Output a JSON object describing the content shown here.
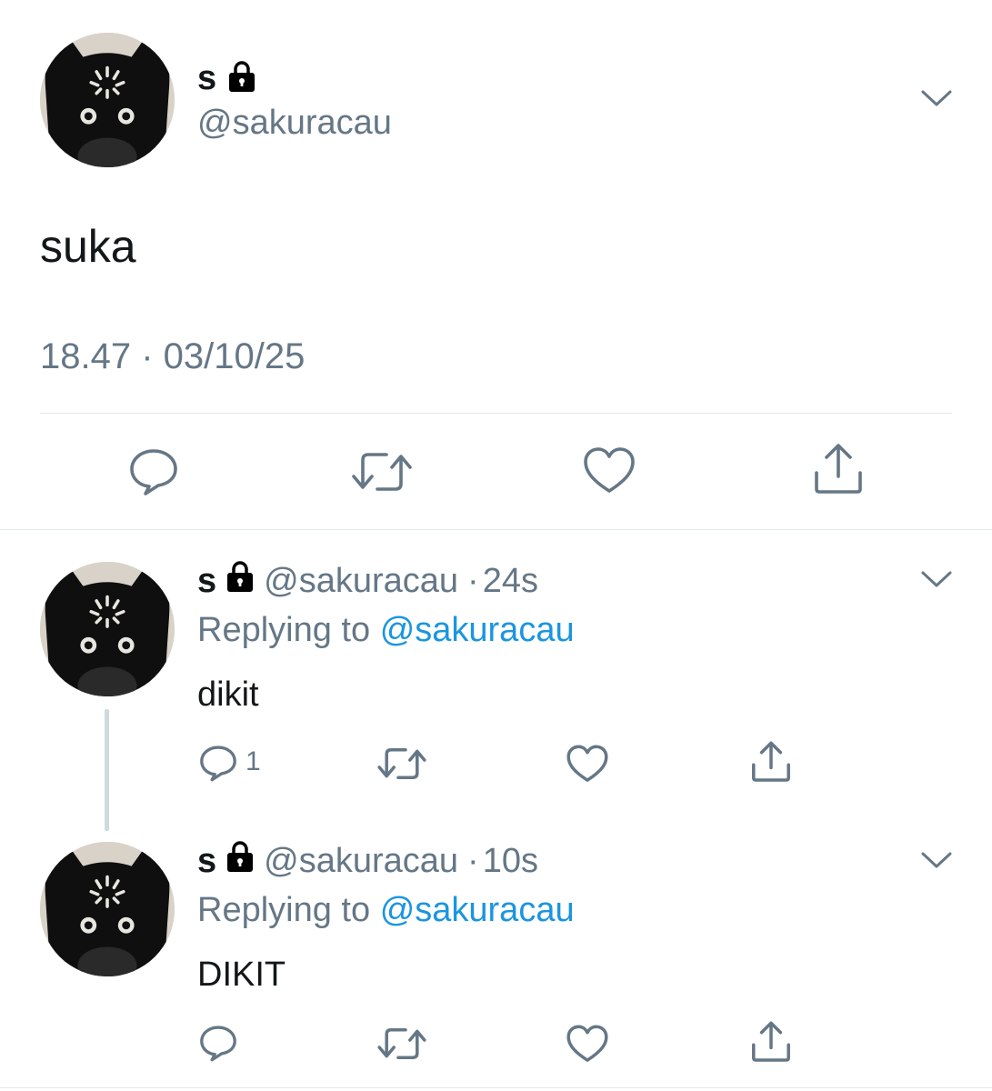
{
  "main_tweet": {
    "display_name": "s",
    "handle": "@sakuracau",
    "text": "suka",
    "timestamp": "18.47 · 03/10/25"
  },
  "replies": [
    {
      "display_name": "s",
      "handle": "@sakuracau",
      "time": "24s",
      "replying_prefix": "Replying to",
      "replying_handle": "@sakuracau",
      "text": "dikit",
      "reply_count": "1"
    },
    {
      "display_name": "s",
      "handle": "@sakuracau",
      "time": "10s",
      "replying_prefix": "Replying to",
      "replying_handle": "@sakuracau",
      "text": "DIKIT",
      "reply_count": ""
    }
  ],
  "icons": [
    "lock-icon",
    "chevron-down-icon",
    "reply-icon",
    "retweet-icon",
    "like-icon",
    "share-icon"
  ],
  "colors": {
    "text": "#14171a",
    "muted": "#657786",
    "link": "#1b95e0",
    "divider": "#e1e8ed",
    "thread_line": "#cfd9de"
  }
}
